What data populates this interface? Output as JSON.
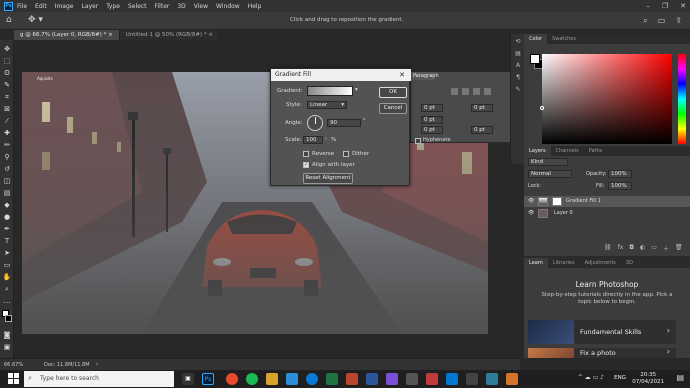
{
  "menu": {
    "items": [
      "File",
      "Edit",
      "Image",
      "Layer",
      "Type",
      "Select",
      "Filter",
      "3D",
      "View",
      "Window",
      "Help"
    ],
    "window_controls": [
      "–",
      "❐",
      "✕"
    ]
  },
  "options": {
    "hint": "Click and drag to reposition the gradient."
  },
  "tabs": [
    {
      "label": "g @ 66.7% (Layer 0, RGB/8#) * ×"
    },
    {
      "label": "Untitled-1 @ 50% (RGB/8#) * ×"
    }
  ],
  "dialog": {
    "title": "Gradient Fill",
    "gradient_label": "Gradient:",
    "style_label": "Style:",
    "style_value": "Linear",
    "angle_label": "Angle:",
    "angle_value": "90",
    "angle_unit": "°",
    "scale_label": "Scale:",
    "scale_value": "100",
    "scale_unit": "%",
    "reverse_label": "Reverse",
    "dither_label": "Dither",
    "align_label": "Align with layer",
    "reset_label": "Reset Alignment",
    "ok_label": "OK",
    "cancel_label": "Cancel",
    "reverse_checked": false,
    "dither_checked": false,
    "align_checked": true
  },
  "paragraph": {
    "tab": "Paragraph",
    "fields": [
      "0 pt",
      "0 pt",
      "0 pt",
      "0 pt",
      "0 pt"
    ],
    "hyphenate": "Hyphenate"
  },
  "color_panel": {
    "tabs": [
      "Color",
      "Swatches"
    ],
    "foreground": "#ffffff",
    "background": "#000000"
  },
  "layers_panel": {
    "tabs": [
      "Layers",
      "Channels",
      "Paths"
    ],
    "kind": "Kind",
    "blend": "Normal",
    "opacity_label": "Opacity:",
    "opacity_value": "100%",
    "lock_label": "Lock:",
    "fill_label": "Fill:",
    "fill_value": "100%",
    "layers": [
      {
        "name": "Gradient Fill 1",
        "selected": true
      },
      {
        "name": "Layer 0",
        "selected": false
      }
    ]
  },
  "learn_panel": {
    "tabs": [
      "Learn",
      "Libraries",
      "Adjustments",
      "3D"
    ],
    "heading": "Learn Photoshop",
    "description": "Step-by-step tutorials directly in the app. Pick a topic below to begin.",
    "cards": [
      {
        "label": "Fundamental Skills"
      },
      {
        "label": "Fix a photo"
      }
    ]
  },
  "status": {
    "zoom": "66.67%",
    "doc": "Doc: 11.8M/11.8M"
  },
  "canvas": {
    "corner_label": "Aquisits"
  },
  "taskbar": {
    "search_placeholder": "Type here to search",
    "lang": "ENG",
    "time": "20:35",
    "date": "07/04/2021"
  }
}
